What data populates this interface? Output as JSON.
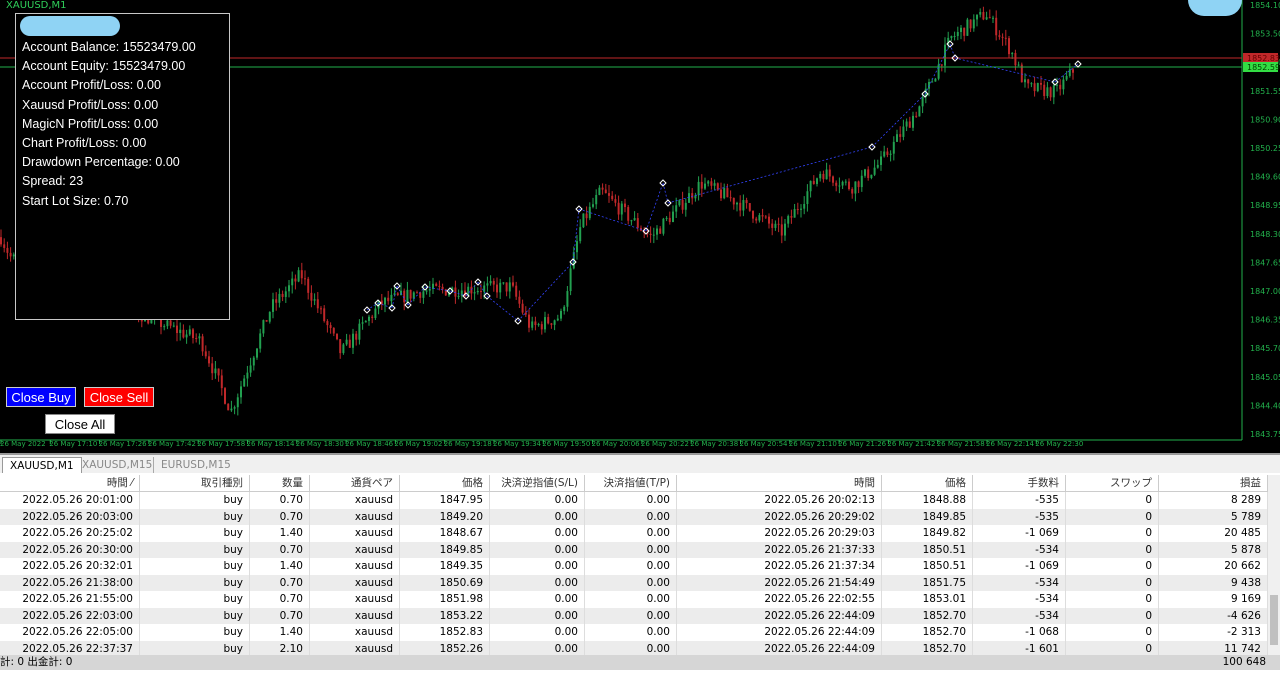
{
  "chart": {
    "symbol": "XAUUSD,M1",
    "bid_line": "1852.59",
    "ask_line": "1852.83",
    "price_axis": [
      "1854.10",
      "1853.50",
      "1852.20",
      "1851.55",
      "1850.90",
      "1850.25",
      "1849.60",
      "1848.95",
      "1848.30",
      "1847.65",
      "1847.00",
      "1846.35",
      "1845.70",
      "1845.05",
      "1844.40",
      "1843.75"
    ],
    "time_axis": [
      "26 May 2022",
      "26 May 17:10",
      "26 May 17:26",
      "26 May 17:42",
      "26 May 17:58",
      "26 May 18:14",
      "26 May 18:30",
      "26 May 18:46",
      "26 May 19:02",
      "26 May 19:18",
      "26 May 19:34",
      "26 May 19:50",
      "26 May 20:06",
      "26 May 20:22",
      "26 May 20:38",
      "26 May 20:54",
      "26 May 21:10",
      "26 May 21:26",
      "26 May 21:42",
      "26 May 21:58",
      "26 May 22:14",
      "26 May 22:30"
    ],
    "colors": {
      "background": "#000000",
      "axis": "#22b14c",
      "bull": "#22a050",
      "bear": "#c0282a",
      "bid": "#22b14c",
      "ask": "#c0282a"
    }
  },
  "panel": {
    "lines": [
      "Account Balance: 15523479.00",
      "Account Equity: 15523479.00",
      "Account Profit/Loss: 0.00",
      "Xauusd Profit/Loss: 0.00",
      "MagicN Profit/Loss: 0.00",
      "Chart Profit/Loss: 0.00",
      "Drawdown Percentage: 0.00",
      "Spread: 23",
      "Start Lot Size: 0.70"
    ]
  },
  "buttons": {
    "close_buy": "Close Buy",
    "close_sell": "Close Sell",
    "close_all": "Close All"
  },
  "tabs": [
    "XAUUSD,M1",
    "XAUUSD,M15",
    "EURUSD,M15"
  ],
  "table": {
    "columns": [
      "時間 ⁄",
      "取引種別",
      "数量",
      "通貨ペア",
      "価格",
      "決済逆指値(S/L)",
      "決済指値(T/P)",
      "時間",
      "価格",
      "手数料",
      "スワップ",
      "損益"
    ],
    "rows": [
      [
        "2022.05.26 20:01:00",
        "buy",
        "0.70",
        "xauusd",
        "1847.95",
        "0.00",
        "0.00",
        "2022.05.26 20:02:13",
        "1848.88",
        "-535",
        "0",
        "8 289"
      ],
      [
        "2022.05.26 20:03:00",
        "buy",
        "0.70",
        "xauusd",
        "1849.20",
        "0.00",
        "0.00",
        "2022.05.26 20:29:02",
        "1849.85",
        "-535",
        "0",
        "5 789"
      ],
      [
        "2022.05.26 20:25:02",
        "buy",
        "1.40",
        "xauusd",
        "1848.67",
        "0.00",
        "0.00",
        "2022.05.26 20:29:03",
        "1849.82",
        "-1 069",
        "0",
        "20 485"
      ],
      [
        "2022.05.26 20:30:00",
        "buy",
        "0.70",
        "xauusd",
        "1849.85",
        "0.00",
        "0.00",
        "2022.05.26 21:37:33",
        "1850.51",
        "-534",
        "0",
        "5 878"
      ],
      [
        "2022.05.26 20:32:01",
        "buy",
        "1.40",
        "xauusd",
        "1849.35",
        "0.00",
        "0.00",
        "2022.05.26 21:37:34",
        "1850.51",
        "-1 069",
        "0",
        "20 662"
      ],
      [
        "2022.05.26 21:38:00",
        "buy",
        "0.70",
        "xauusd",
        "1850.69",
        "0.00",
        "0.00",
        "2022.05.26 21:54:49",
        "1851.75",
        "-534",
        "0",
        "9 438"
      ],
      [
        "2022.05.26 21:55:00",
        "buy",
        "0.70",
        "xauusd",
        "1851.98",
        "0.00",
        "0.00",
        "2022.05.26 22:02:55",
        "1853.01",
        "-534",
        "0",
        "9 169"
      ],
      [
        "2022.05.26 22:03:00",
        "buy",
        "0.70",
        "xauusd",
        "1853.22",
        "0.00",
        "0.00",
        "2022.05.26 22:44:09",
        "1852.70",
        "-534",
        "0",
        "-4 626"
      ],
      [
        "2022.05.26 22:05:00",
        "buy",
        "1.40",
        "xauusd",
        "1852.83",
        "0.00",
        "0.00",
        "2022.05.26 22:44:09",
        "1852.70",
        "-1 068",
        "0",
        "-2 313"
      ],
      [
        "2022.05.26 22:37:37",
        "buy",
        "2.10",
        "xauusd",
        "1852.26",
        "0.00",
        "0.00",
        "2022.05.26 22:44:09",
        "1852.70",
        "-1 601",
        "0",
        "11 742"
      ]
    ],
    "footer_left": "計: 0  出金計: 0",
    "footer_total": "100 648"
  }
}
